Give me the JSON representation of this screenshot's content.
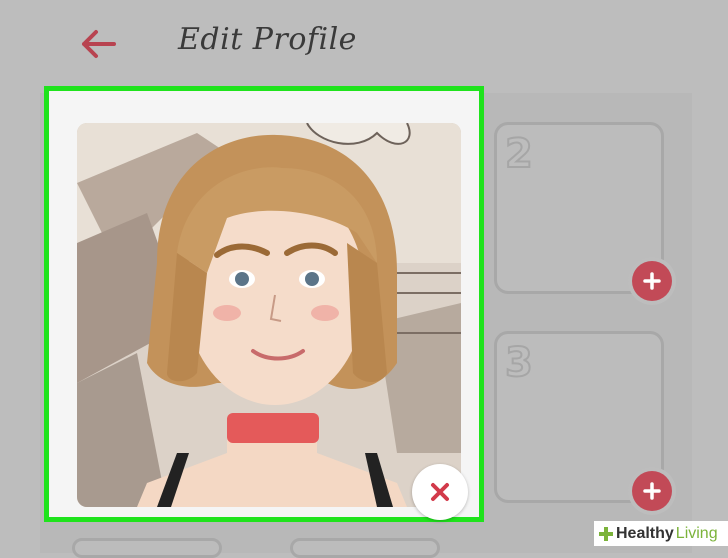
{
  "header": {
    "title": "Edit Profile",
    "back_icon": "arrow-left-icon"
  },
  "photo_slots": [
    {
      "number": "2",
      "action_icon": "plus-icon"
    },
    {
      "number": "3",
      "action_icon": "plus-icon"
    }
  ],
  "main_photo": {
    "action_icon": "close-icon"
  },
  "watermark": {
    "brand_bold": "Healthy",
    "brand_light": "Living"
  },
  "colors": {
    "accent": "#c24a57",
    "selection": "#1fe31c",
    "background": "#bdbdbd"
  }
}
